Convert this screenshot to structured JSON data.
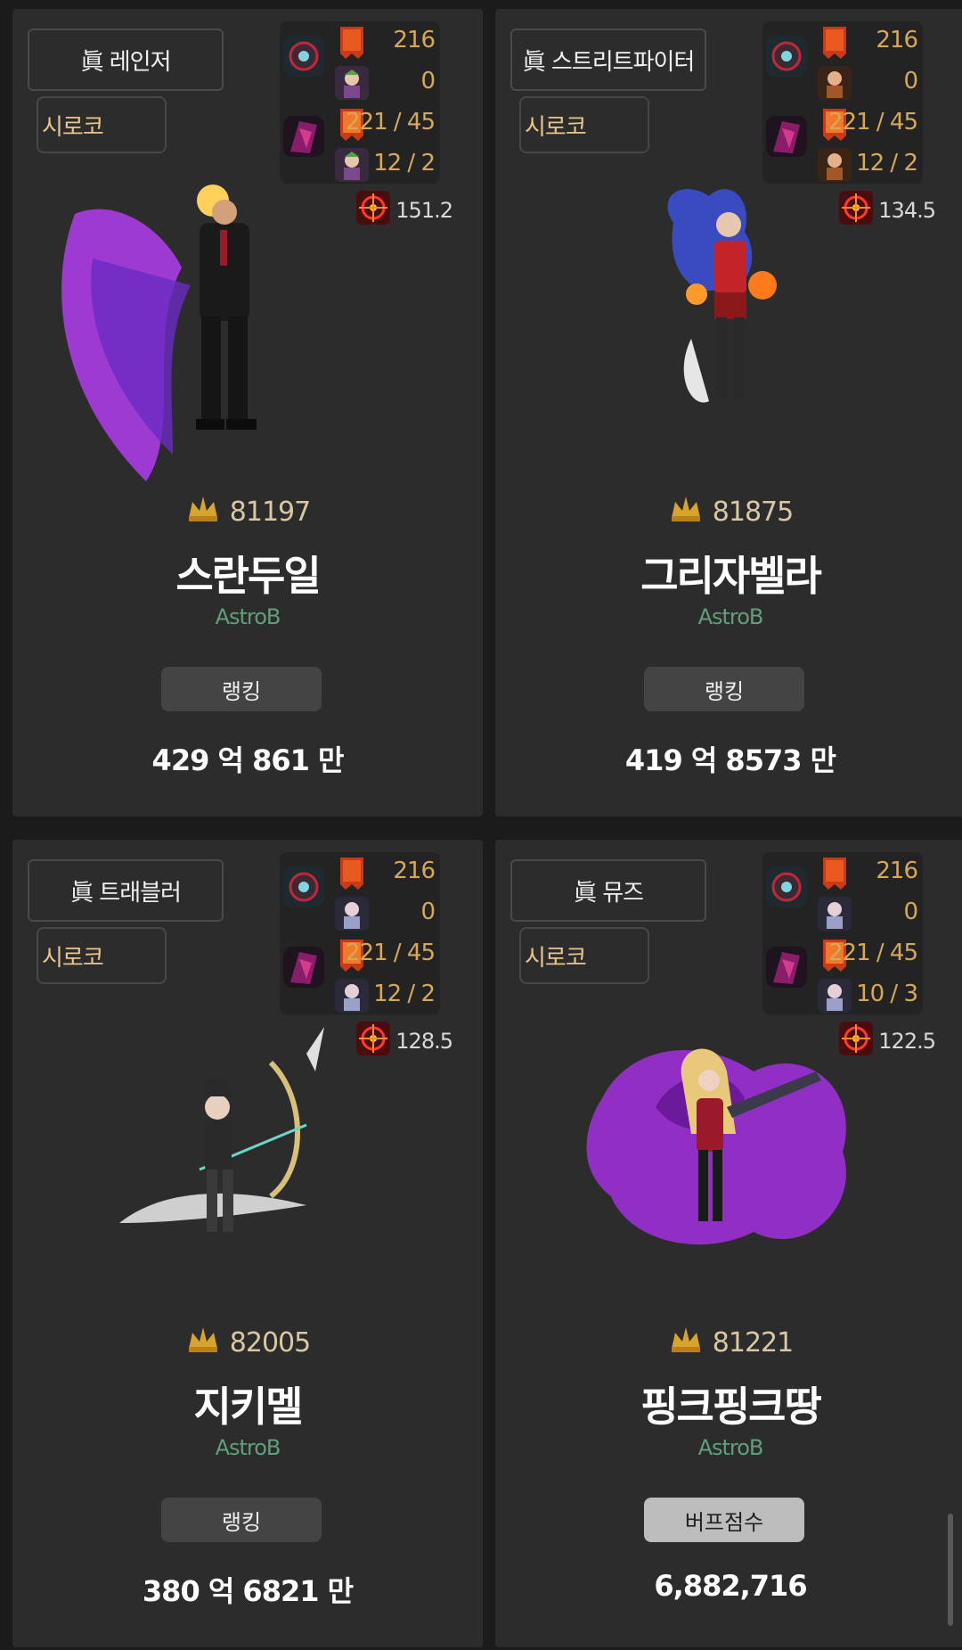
{
  "cards": [
    {
      "job": "眞 레인저",
      "server": "시로코",
      "stats": {
        "set_points": "216",
        "gear_level": "0",
        "mist": "221 / 45",
        "creature": "12 / 2"
      },
      "power": "151.2",
      "fame": "81197",
      "character_name": "스란두일",
      "adventure": "AstroB",
      "button": "랭킹",
      "score": "429 억 861 만",
      "art_color": "#b13df0"
    },
    {
      "job": "眞 스트리트파이터",
      "server": "시로코",
      "stats": {
        "set_points": "216",
        "gear_level": "0",
        "mist": "221 / 45",
        "creature": "12 / 2"
      },
      "power": "134.5",
      "fame": "81875",
      "character_name": "그리자벨라",
      "adventure": "AstroB",
      "button": "랭킹",
      "score": "419 억 8573 만",
      "art_color": "#3a4bc2"
    },
    {
      "job": "眞 트래블러",
      "server": "시로코",
      "stats": {
        "set_points": "216",
        "gear_level": "0",
        "mist": "221 / 45",
        "creature": "12 / 2"
      },
      "power": "128.5",
      "fame": "82005",
      "character_name": "지키멜",
      "adventure": "AstroB",
      "button": "랭킹",
      "score": "380 억 6821 만",
      "art_color": "#cfcfcf"
    },
    {
      "job": "眞 뮤즈",
      "server": "시로코",
      "stats": {
        "set_points": "216",
        "gear_level": "0",
        "mist": "221 / 45",
        "creature": "10 / 3"
      },
      "power": "122.5",
      "fame": "81221",
      "character_name": "핑크핑크땅",
      "adventure": "AstroB",
      "button": "버프점수",
      "score": "6,882,716",
      "art_color": "#a330e0"
    }
  ],
  "icons": {
    "emblem": "emblem-icon",
    "medal": "medal-icon",
    "creature": "creature-icon",
    "power": "crosshair-icon",
    "fame": "fame-crown-icon"
  }
}
